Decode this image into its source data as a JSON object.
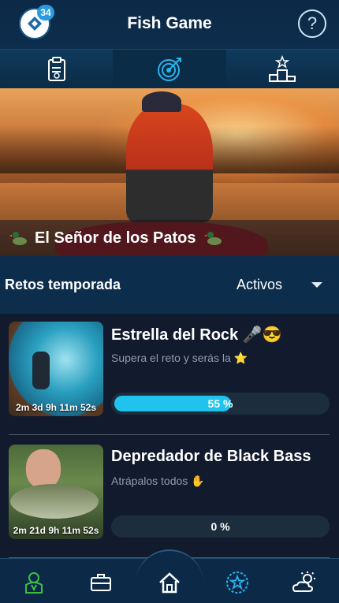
{
  "header": {
    "title": "Fish Game",
    "badge_count": "34",
    "help_label": "?"
  },
  "tabs": [
    {
      "name": "clipboard-icon",
      "active": false
    },
    {
      "name": "target-icon",
      "active": true
    },
    {
      "name": "podium-icon",
      "active": false
    }
  ],
  "hero": {
    "title": "El Señor de los Patos"
  },
  "section": {
    "title": "Retos temporada",
    "filter_value": "Activos"
  },
  "challenges": [
    {
      "title": "Estrella del Rock 🎤😎",
      "subtitle": "Supera el reto y serás la ⭐",
      "timer": "2m 3d 9h 11m 52s",
      "progress": 0.55,
      "progress_label": "55 %"
    },
    {
      "title": "Depredador de Black Bass",
      "subtitle": "Atrápalos todos ✋",
      "timer": "2m 21d 9h 11m 52s",
      "progress": 0,
      "progress_label": "0 %"
    }
  ],
  "bottom_nav": [
    {
      "name": "profile-icon",
      "color": "#3fbf3f"
    },
    {
      "name": "briefcase-icon",
      "color": "#ffffff"
    },
    {
      "name": "home-icon",
      "color": "#ffffff"
    },
    {
      "name": "star-badge-icon",
      "color": "#2ab3ee"
    },
    {
      "name": "weather-icon",
      "color": "#ffffff"
    }
  ],
  "colors": {
    "header_bg": "#0c2a48",
    "accent": "#20c3ee",
    "list_bg": "#121a2e"
  }
}
